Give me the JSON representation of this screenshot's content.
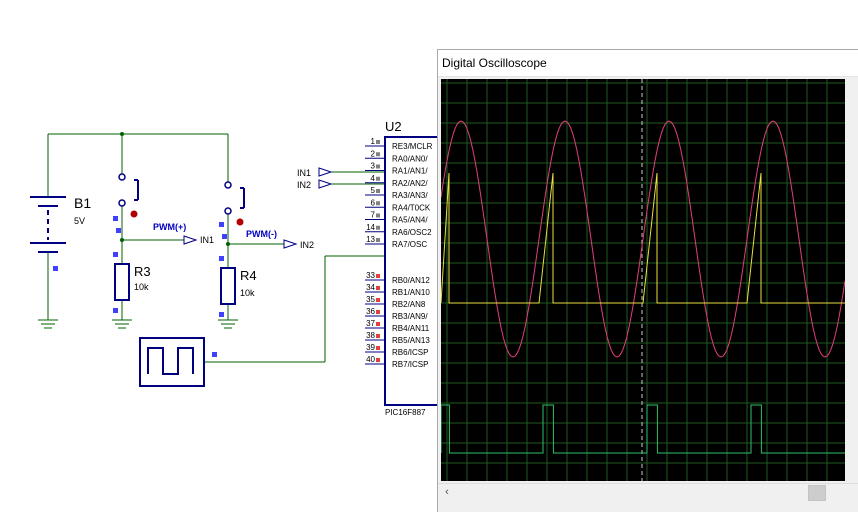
{
  "schematic": {
    "battery": {
      "ref": "B1",
      "value": "5V"
    },
    "resistors": [
      {
        "ref": "R3",
        "value": "10k"
      },
      {
        "ref": "R4",
        "value": "10k"
      }
    ],
    "net_labels": {
      "pwm_plus": "PWM(+)",
      "pwm_minus": "PWM(-)"
    },
    "terminals": {
      "in1": "IN1",
      "in2": "IN2"
    },
    "mcu": {
      "ref": "U2",
      "part": "PIC16F887",
      "pins_a": [
        {
          "num": "1",
          "name": "RE3/MCLR"
        },
        {
          "num": "2",
          "name": "RA0/AN0/"
        },
        {
          "num": "3",
          "name": "RA1/AN1/"
        },
        {
          "num": "4",
          "name": "RA2/AN2/"
        },
        {
          "num": "5",
          "name": "RA3/AN3/"
        },
        {
          "num": "6",
          "name": "RA4/T0CK"
        },
        {
          "num": "7",
          "name": "RA5/AN4/"
        },
        {
          "num": "14",
          "name": "RA6/OSC2"
        },
        {
          "num": "13",
          "name": "RA7/OSC"
        }
      ],
      "pins_b": [
        {
          "num": "33",
          "name": "RB0/AN12"
        },
        {
          "num": "34",
          "name": "RB1/AN10"
        },
        {
          "num": "35",
          "name": "RB2/AN8"
        },
        {
          "num": "36",
          "name": "RB3/AN9/"
        },
        {
          "num": "37",
          "name": "RB4/AN11"
        },
        {
          "num": "38",
          "name": "RB5/AN13"
        },
        {
          "num": "39",
          "name": "RB6/ICSP"
        },
        {
          "num": "40",
          "name": "RB7/ICSP"
        }
      ]
    }
  },
  "oscilloscope": {
    "title": "Digital Oscilloscope",
    "scroll_left_icon": "chevron-left-icon",
    "colors": {
      "background": "#000000",
      "grid": "#1f5a1f",
      "sine_trace": "#e0407a",
      "sawtooth_trace": "#e8e040",
      "square_trace": "#2fbf6a"
    },
    "traces": {
      "sine": {
        "cycles_visible": 4,
        "period_divisions": 5.2
      },
      "square": {
        "duty": 0.1
      }
    }
  }
}
